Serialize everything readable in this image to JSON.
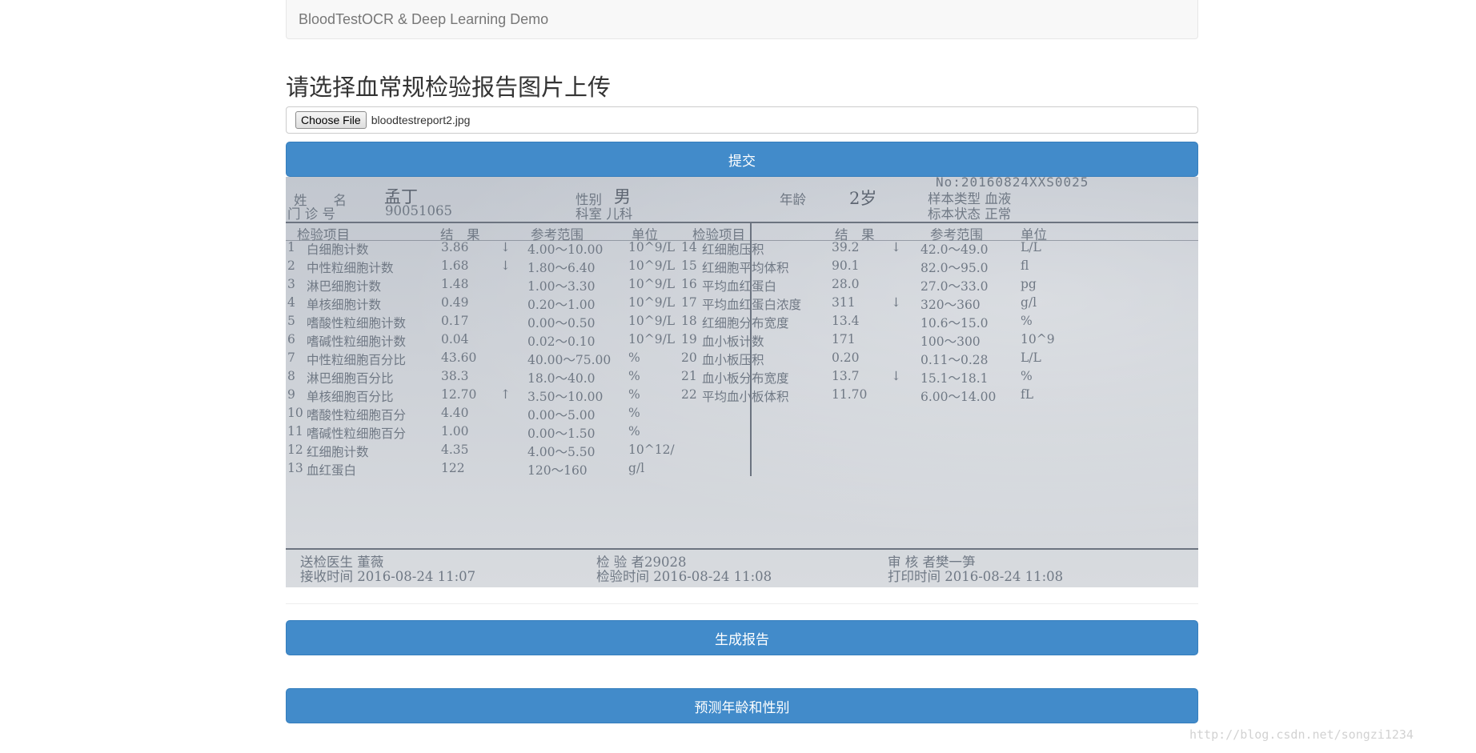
{
  "navbar": {
    "brand": "BloodTestOCR & Deep Learning Demo"
  },
  "page_title": "请选择血常规检验报告图片上传",
  "file_input": {
    "button_label": "Choose File",
    "file_name": "bloodtestreport2.jpg"
  },
  "buttons": {
    "submit": "提交",
    "generate_report": "生成报告",
    "predict": "预测年龄和性别"
  },
  "report": {
    "number": "No:20160824XXS0025",
    "name_label": "姓　　名",
    "name": "孟丁",
    "gender_label": "性别",
    "gender": "男",
    "age_label": "年龄",
    "age": "2岁",
    "sample_type": "样本类型 血液",
    "clinic_label": "门 诊 号",
    "clinic_no": "90051065",
    "department": "科室 儿科",
    "sample_status": "标本状态 正常",
    "left_headers": [
      "检验项目",
      "结　果",
      "参考范围",
      "单位"
    ],
    "right_headers": [
      "检验项目",
      "结　果",
      "参考范围",
      "单位"
    ],
    "left_rows": [
      {
        "no": "1",
        "name": "白细胞计数",
        "value": "3.86",
        "flag": "↓",
        "range": "4.00～10.00",
        "unit": "10^9/L"
      },
      {
        "no": "2",
        "name": "中性粒细胞计数",
        "value": "1.68",
        "flag": "↓",
        "range": "1.80～6.40",
        "unit": "10^9/L"
      },
      {
        "no": "3",
        "name": "淋巴细胞计数",
        "value": "1.48",
        "flag": "",
        "range": "1.00～3.30",
        "unit": "10^9/L"
      },
      {
        "no": "4",
        "name": "单核细胞计数",
        "value": "0.49",
        "flag": "",
        "range": "0.20～1.00",
        "unit": "10^9/L"
      },
      {
        "no": "5",
        "name": "嗜酸性粒细胞计数",
        "value": "0.17",
        "flag": "",
        "range": "0.00～0.50",
        "unit": "10^9/L"
      },
      {
        "no": "6",
        "name": "嗜碱性粒细胞计数",
        "value": "0.04",
        "flag": "",
        "range": "0.02～0.10",
        "unit": "10^9/L"
      },
      {
        "no": "7",
        "name": "中性粒细胞百分比",
        "value": "43.60",
        "flag": "",
        "range": "40.00～75.00",
        "unit": "%"
      },
      {
        "no": "8",
        "name": "淋巴细胞百分比",
        "value": "38.3",
        "flag": "",
        "range": "18.0～40.0",
        "unit": "%"
      },
      {
        "no": "9",
        "name": "单核细胞百分比",
        "value": "12.70",
        "flag": "↑",
        "range": "3.50～10.00",
        "unit": "%"
      },
      {
        "no": "10",
        "name": "嗜酸性粒细胞百分",
        "value": "4.40",
        "flag": "",
        "range": "0.00～5.00",
        "unit": "%"
      },
      {
        "no": "11",
        "name": "嗜碱性粒细胞百分",
        "value": "1.00",
        "flag": "",
        "range": "0.00～1.50",
        "unit": "%"
      },
      {
        "no": "12",
        "name": "红细胞计数",
        "value": "4.35",
        "flag": "",
        "range": "4.00～5.50",
        "unit": "10^12/"
      },
      {
        "no": "13",
        "name": "血红蛋白",
        "value": "122",
        "flag": "",
        "range": "120～160",
        "unit": "g/l"
      }
    ],
    "right_rows": [
      {
        "no": "14",
        "name": "红细胞压积",
        "value": "39.2",
        "flag": "↓",
        "range": "42.0～49.0",
        "unit": "L/L"
      },
      {
        "no": "15",
        "name": "红细胞平均体积",
        "value": "90.1",
        "flag": "",
        "range": "82.0～95.0",
        "unit": "fl"
      },
      {
        "no": "16",
        "name": "平均血红蛋白",
        "value": "28.0",
        "flag": "",
        "range": "27.0～33.0",
        "unit": "pg"
      },
      {
        "no": "17",
        "name": "平均血红蛋白浓度",
        "value": "311",
        "flag": "↓",
        "range": "320～360",
        "unit": "g/l"
      },
      {
        "no": "18",
        "name": "红细胞分布宽度",
        "value": "13.4",
        "flag": "",
        "range": "10.6～15.0",
        "unit": "%"
      },
      {
        "no": "19",
        "name": "血小板计数",
        "value": "171",
        "flag": "",
        "range": "100～300",
        "unit": "10^9"
      },
      {
        "no": "20",
        "name": "血小板压积",
        "value": "0.20",
        "flag": "",
        "range": "0.11～0.28",
        "unit": "L/L"
      },
      {
        "no": "21",
        "name": "血小板分布宽度",
        "value": "13.7",
        "flag": "↓",
        "range": "15.1～18.1",
        "unit": "%"
      },
      {
        "no": "22",
        "name": "平均血小板体积",
        "value": "11.70",
        "flag": "",
        "range": "6.00～14.00",
        "unit": "fL"
      }
    ],
    "footer": {
      "doctor": "送检医生 董薇",
      "tester": "检 验 者29028",
      "reviewer": "审 核 者樊一笋",
      "received": "接收时间 2016-08-24 11:07",
      "tested": "检验时间 2016-08-24 11:08",
      "printed": "打印时间 2016-08-24 11:08"
    }
  },
  "watermark": "http://blog.csdn.net/songzi1234"
}
